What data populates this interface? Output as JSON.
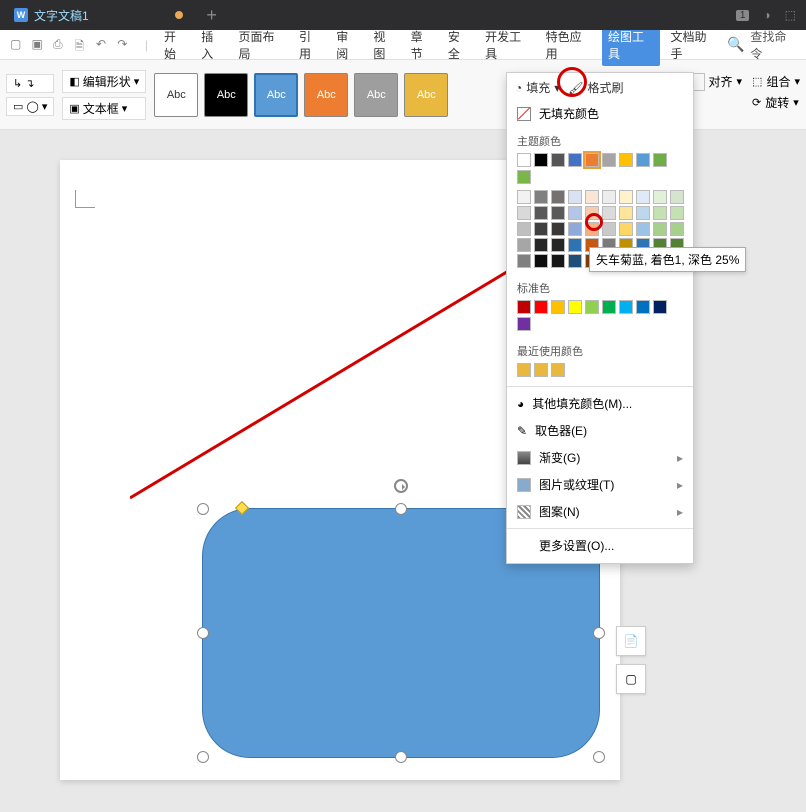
{
  "titlebar": {
    "doc_title": "文字文稿1",
    "tab_badge": "1"
  },
  "menubar": {
    "items": [
      "开始",
      "插入",
      "页面布局",
      "引用",
      "审阅",
      "视图",
      "章节",
      "安全",
      "开发工具",
      "特色应用",
      "绘图工具",
      "文档助手"
    ],
    "active_index": 10,
    "search_placeholder": "查找命令"
  },
  "toolbar": {
    "edit_shape": "编辑形状",
    "text_box": "文本框",
    "styles": [
      "Abc",
      "Abc",
      "Abc",
      "Abc",
      "Abc",
      "Abc"
    ],
    "fill_label": "填充",
    "format_painter": "格式刷",
    "align": "对齐",
    "group": "组合",
    "rotate": "旋转"
  },
  "color_dropdown": {
    "no_fill": "无填充颜色",
    "theme_label": "主题颜色",
    "standard_label": "标准色",
    "recent_label": "最近使用颜色",
    "more_colors": "其他填充颜色(M)...",
    "eyedropper": "取色器(E)",
    "gradient": "渐变(G)",
    "texture": "图片或纹理(T)",
    "pattern": "图案(N)",
    "more_settings": "更多设置(O)...",
    "tooltip": "矢车菊蓝, 着色1, 深色 25%",
    "theme_row": [
      "#ffffff",
      "#000000",
      "#555555",
      "#4472c4",
      "#ed7d31",
      "#a5a5a5",
      "#ffc000",
      "#5b9bd5",
      "#70ad47",
      "#7ab648"
    ],
    "standard": [
      "#c00000",
      "#ff0000",
      "#ffc000",
      "#ffff00",
      "#92d050",
      "#00b050",
      "#00b0f0",
      "#0070c0",
      "#002060",
      "#7030a0"
    ],
    "recent": [
      "#e8b93e",
      "#e8b93e",
      "#e8b93e"
    ],
    "shade_cols": [
      [
        "#f2f2f2",
        "#d9d9d9",
        "#bfbfbf",
        "#a6a6a6",
        "#808080"
      ],
      [
        "#808080",
        "#595959",
        "#404040",
        "#262626",
        "#0d0d0d"
      ],
      [
        "#767171",
        "#5a5a5a",
        "#3b3838",
        "#262626",
        "#161616"
      ],
      [
        "#d9e2f3",
        "#b4c6e7",
        "#8eaadb",
        "#2e74b5",
        "#1f4e79"
      ],
      [
        "#fbe5d5",
        "#f7cbac",
        "#f4b183",
        "#c55a11",
        "#833c0c"
      ],
      [
        "#ededed",
        "#dbdbdb",
        "#c9c9c9",
        "#7b7b7b",
        "#525252"
      ],
      [
        "#fff2cc",
        "#fee599",
        "#fdd766",
        "#bf9000",
        "#7f6000"
      ],
      [
        "#deebf6",
        "#bdd7ee",
        "#9cc3e5",
        "#2e75b5",
        "#1e4e79"
      ],
      [
        "#e2efd9",
        "#c5e0b3",
        "#a8d08d",
        "#538135",
        "#375623"
      ],
      [
        "#d5e3cf",
        "#c5e0b3",
        "#a8d08d",
        "#538135",
        "#375623"
      ]
    ]
  }
}
